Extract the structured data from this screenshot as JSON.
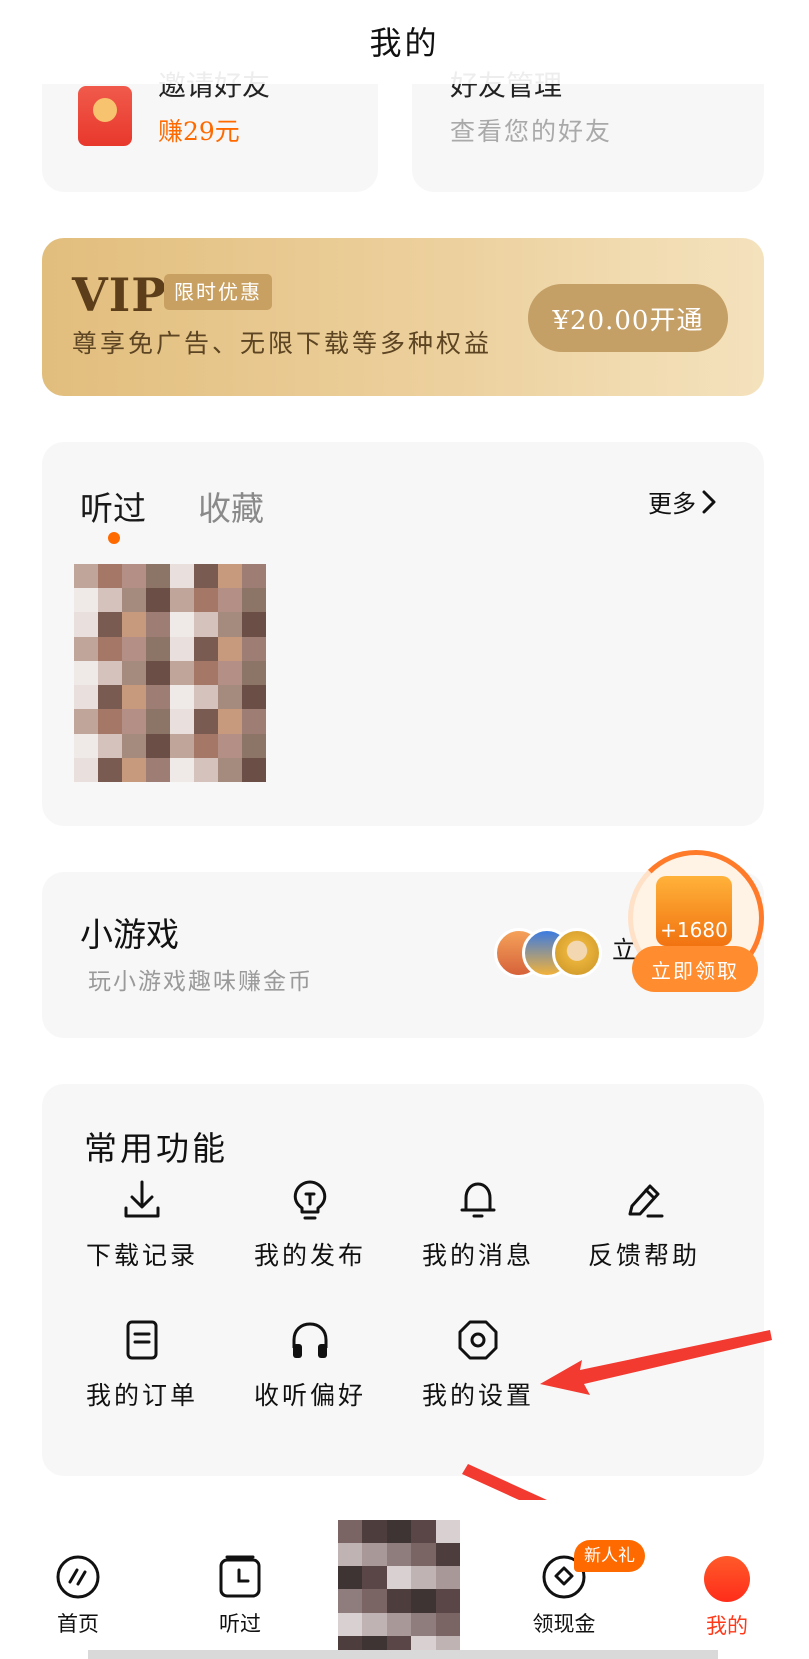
{
  "header": {
    "title": "我的"
  },
  "friends": {
    "invite": {
      "title": "邀请好友",
      "reward": "赚29元"
    },
    "manage": {
      "title": "好友管理",
      "subtitle": "查看您的好友"
    }
  },
  "vip": {
    "logo": "VIP",
    "badge": "限时优惠",
    "description": "尊享免广告、无限下载等多种权益",
    "button": "¥20.00开通"
  },
  "recent": {
    "tabs": [
      "听过",
      "收藏"
    ],
    "more": "更多"
  },
  "games": {
    "title": "小游戏",
    "subtitle": "玩小游戏趣味赚金币",
    "cta_partial": "立"
  },
  "reward_widget": {
    "amount": "+1680",
    "button": "立即领取"
  },
  "functions": {
    "title": "常用功能",
    "items": [
      {
        "label": "下载记录",
        "icon": "download-icon"
      },
      {
        "label": "我的发布",
        "icon": "lightbulb-icon"
      },
      {
        "label": "我的消息",
        "icon": "bell-icon"
      },
      {
        "label": "反馈帮助",
        "icon": "pencil-icon"
      },
      {
        "label": "我的订单",
        "icon": "document-icon"
      },
      {
        "label": "收听偏好",
        "icon": "headphones-icon"
      },
      {
        "label": "我的设置",
        "icon": "settings-icon"
      }
    ]
  },
  "tabbar": {
    "items": [
      {
        "label": "首页",
        "icon": "home-icon"
      },
      {
        "label": "听过",
        "icon": "history-icon"
      },
      {
        "label": "领现金",
        "icon": "cash-icon"
      },
      {
        "label": "我的",
        "icon": "profile-icon"
      }
    ],
    "new_badge": "新人礼"
  },
  "colors": {
    "accent": "#ff6a00",
    "vip_gold": "#c49f66",
    "card_bg": "#f7f7f7",
    "arrow": "#f23a30"
  }
}
